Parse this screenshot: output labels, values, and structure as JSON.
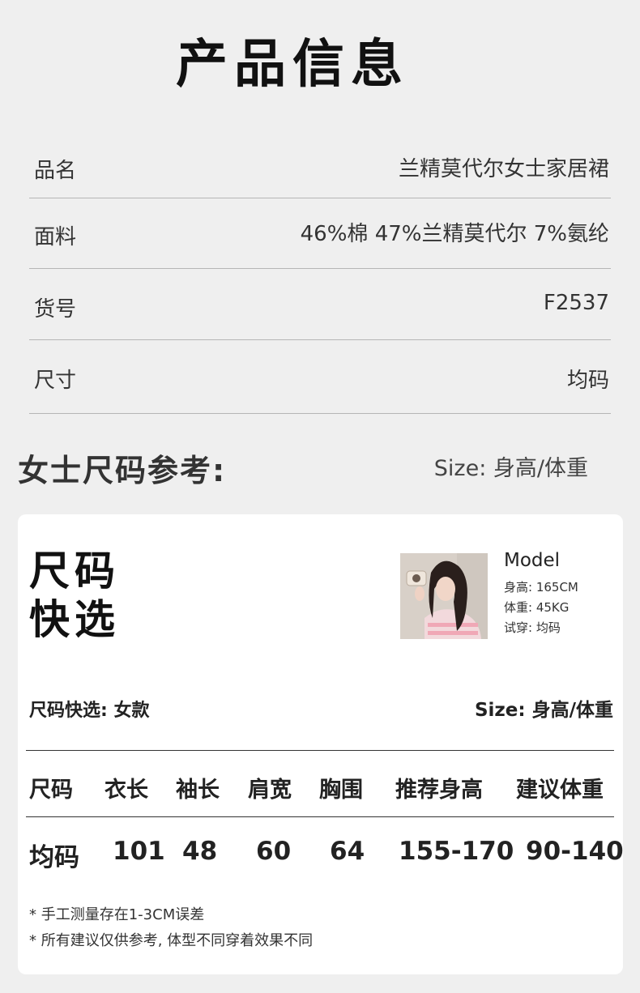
{
  "title": "产品信息",
  "product_info": [
    {
      "label": "品名",
      "value": "兰精莫代尔女士家居裙"
    },
    {
      "label": "面料",
      "value": "46%棉 47%兰精莫代尔 7%氨纶"
    },
    {
      "label": "货号",
      "value": "F2537"
    },
    {
      "label": "尺寸",
      "value": "均码"
    }
  ],
  "size_section": {
    "heading": "女士尺码参考:",
    "size_label": "Size: 身高/体重"
  },
  "card": {
    "quick_title_line1": "尺码",
    "quick_title_line2": "快选",
    "model": {
      "name": "Model",
      "height": "身高: 165CM",
      "weight": "体重: 45KG",
      "fit": "试穿: 均码"
    },
    "sub_left": "尺码快选: 女款",
    "sub_right": "Size: 身高/体重",
    "table": {
      "headers": [
        "尺码",
        "衣长",
        "袖长",
        "肩宽",
        "胸围",
        "推荐身高",
        "建议体重"
      ],
      "row": [
        "均码",
        "101",
        "48",
        "60",
        "64",
        "155-170",
        "90-140"
      ]
    },
    "notes": [
      "* 手工测量存在1-3CM误差",
      "* 所有建议仅供参考, 体型不同穿着效果不同"
    ]
  },
  "colors": {
    "background": "#efefef",
    "card": "#ffffff",
    "divider": "#b5b5b5"
  }
}
